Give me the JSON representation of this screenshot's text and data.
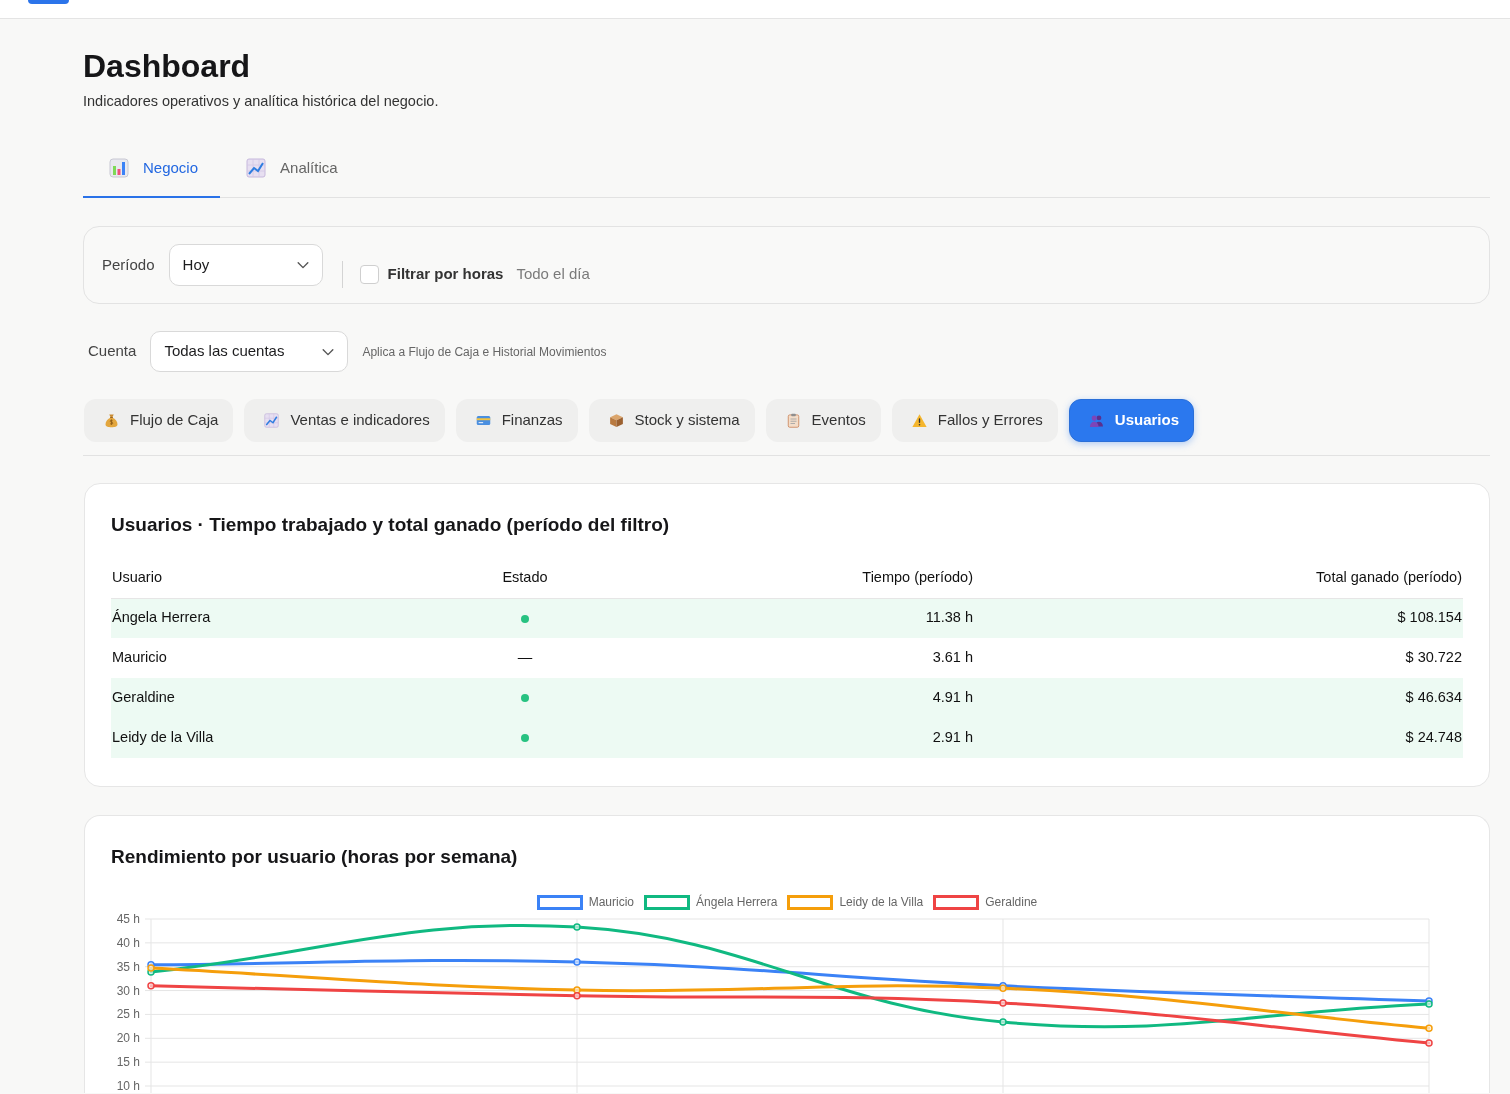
{
  "page": {
    "title": "Dashboard",
    "subtitle": "Indicadores operativos y analítica histórica del negocio."
  },
  "tabs": [
    {
      "label": "Negocio",
      "selected": true
    },
    {
      "label": "Analítica",
      "selected": false
    }
  ],
  "filters": {
    "period": {
      "label": "Período",
      "value": "Hoy"
    },
    "hours_filter": {
      "label": "Filtrar por horas",
      "checked": false,
      "range": "Todo el día"
    }
  },
  "account": {
    "label": "Cuenta",
    "value": "Todas las cuentas",
    "hint": "Aplica a Flujo de Caja e Historial Movimientos"
  },
  "sections": [
    {
      "label": "Flujo de Caja",
      "selected": false
    },
    {
      "label": "Ventas e indicadores",
      "selected": false
    },
    {
      "label": "Finanzas",
      "selected": false
    },
    {
      "label": "Stock y sistema",
      "selected": false
    },
    {
      "label": "Eventos",
      "selected": false
    },
    {
      "label": "Fallos y Errores",
      "selected": false
    },
    {
      "label": "Usuarios",
      "selected": true
    }
  ],
  "users_table": {
    "title": "Usuarios · Tiempo trabajado y total ganado (período del filtro)",
    "columns": [
      "Usuario",
      "Estado",
      "Tiempo (período)",
      "Total ganado (período)"
    ],
    "rows": [
      {
        "user": "Ángela Herrera",
        "active": true,
        "time": "11.38 h",
        "total": "$ 108.154"
      },
      {
        "user": "Mauricio",
        "active": false,
        "status": "—",
        "time": "3.61 h",
        "total": "$ 30.722"
      },
      {
        "user": "Geraldine",
        "active": true,
        "time": "4.91 h",
        "total": "$ 46.634"
      },
      {
        "user": "Leidy de la Villa",
        "active": true,
        "time": "2.91 h",
        "total": "$ 24.748"
      }
    ]
  },
  "performance": {
    "title": "Rendimiento por usuario (horas por semana)",
    "chart_data": {
      "type": "line",
      "grid": true,
      "ylim": [
        10,
        45
      ],
      "yticks": [
        {
          "value": 10,
          "label": "10 h"
        },
        {
          "value": 15,
          "label": "15 h"
        },
        {
          "value": 20,
          "label": "20 h"
        },
        {
          "value": 25,
          "label": "25 h"
        },
        {
          "value": 30,
          "label": "30 h"
        },
        {
          "value": 35,
          "label": "35 h"
        },
        {
          "value": 40,
          "label": "40 h"
        },
        {
          "value": 45,
          "label": "45 h"
        }
      ],
      "series": [
        {
          "name": "Mauricio",
          "color": "#3b82f6",
          "marker": "circle",
          "values": [
            35.4,
            36.0,
            31.0,
            27.8
          ]
        },
        {
          "name": "Ángela Herrera",
          "color": "#10b981",
          "marker": "circle",
          "values": [
            33.9,
            43.3,
            23.4,
            27.2
          ]
        },
        {
          "name": "Leidy de la Villa",
          "color": "#f59e0b",
          "marker": "circle",
          "values": [
            34.7,
            30.1,
            30.5,
            22.1
          ]
        },
        {
          "name": "Geraldine",
          "color": "#ef4444",
          "marker": "circle",
          "values": [
            31.0,
            28.9,
            27.4,
            19.0
          ]
        }
      ]
    }
  }
}
